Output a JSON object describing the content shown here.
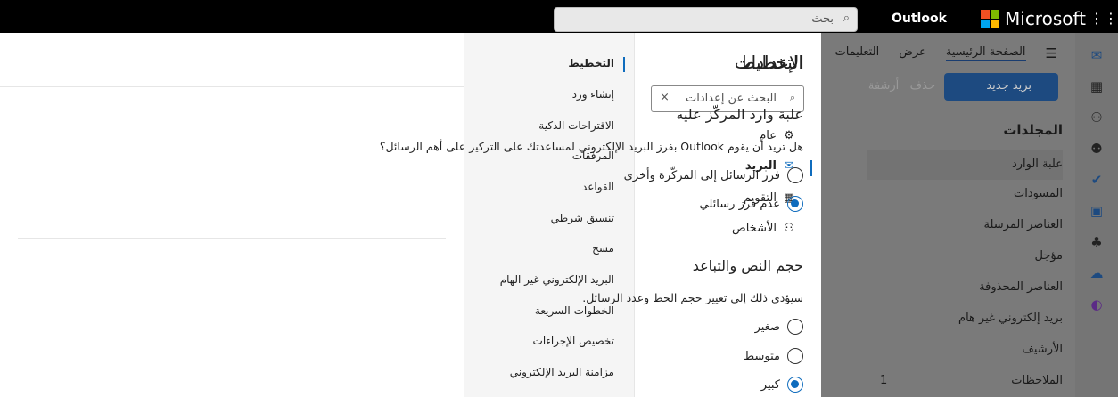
{
  "topbar": {
    "search_placeholder": "بحث",
    "app_name": "Outlook",
    "brand": "Microsoft"
  },
  "background": {
    "tabs": [
      "الصفحة الرئيسية",
      "عرض",
      "التعليمات"
    ],
    "new_mail": "بريد جديد",
    "delete": "حذف",
    "archive": "أرشفة",
    "folders_header": "المجلدات",
    "folders": [
      "علبة الوارد",
      "المسودات",
      "العناصر المرسلة",
      "مؤجل",
      "العناصر المحذوفة",
      "بريد إلكتروني غير هام",
      "الأرشيف",
      "الملاحظات"
    ],
    "notes_count": "1"
  },
  "settings": {
    "title": "الإعدادات",
    "search_placeholder": "البحث عن إعدادات",
    "categories": [
      {
        "label": "عام",
        "icon": "gear-icon"
      },
      {
        "label": "البريد",
        "icon": "mail-icon"
      },
      {
        "label": "التقويم",
        "icon": "calendar-icon"
      },
      {
        "label": "الأشخاص",
        "icon": "people-icon"
      }
    ],
    "subcategories": [
      "التخطيط",
      "إنشاء ورد",
      "الاقتراحات الذكية",
      "المرفقات",
      "القواعد",
      "تنسيق شرطي",
      "مسح",
      "البريد الإلكتروني غير الهام",
      "الخطوات السريعة",
      "تخصيص الإجراءات",
      "مزامنة البريد الإلكتروني"
    ]
  },
  "layout_page": {
    "title": "التخطيط",
    "focused": {
      "heading": "علبة وارد المركّز عليه",
      "question": "هل تريد أن يقوم Outlook بفرز البريد الإلكتروني لمساعدتك على التركيز على أهم الرسائل؟",
      "options": [
        "فرز الرسائل إلى المركّزة وأخرى",
        "عدم فرز رسائلي"
      ],
      "selected": 1
    },
    "text_size": {
      "heading": "حجم النص والتباعد",
      "description": "سيؤدي ذلك إلى تغيير حجم الخط وعدد الرسائل.",
      "options": [
        "صغير",
        "متوسط",
        "كبير"
      ],
      "selected": 2
    }
  },
  "colors": {
    "accent": "#0f6cbd"
  }
}
